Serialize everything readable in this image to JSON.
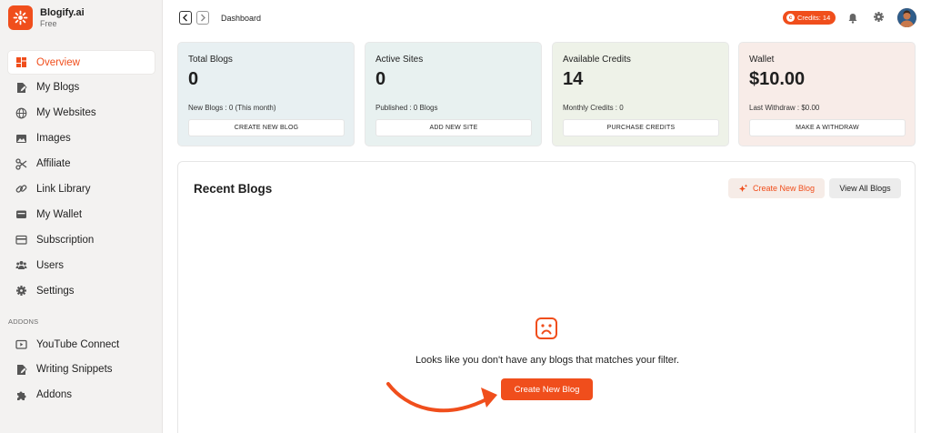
{
  "brand": {
    "name": "Blogify.ai",
    "plan": "Free"
  },
  "sidebar": {
    "items": [
      {
        "label": "Overview",
        "icon": "grid-icon",
        "active": true
      },
      {
        "label": "My Blogs",
        "icon": "edit-doc-icon"
      },
      {
        "label": "My Websites",
        "icon": "globe-icon"
      },
      {
        "label": "Images",
        "icon": "image-icon"
      },
      {
        "label": "Affiliate",
        "icon": "scissors-icon"
      },
      {
        "label": "Link Library",
        "icon": "link-icon"
      },
      {
        "label": "My Wallet",
        "icon": "wallet-icon"
      },
      {
        "label": "Subscription",
        "icon": "card-icon"
      },
      {
        "label": "Users",
        "icon": "users-icon"
      },
      {
        "label": "Settings",
        "icon": "gear-icon"
      }
    ],
    "addons_label": "ADDONS",
    "addons": [
      {
        "label": "YouTube Connect",
        "icon": "youtube-icon"
      },
      {
        "label": "Writing Snippets",
        "icon": "edit-doc-icon"
      },
      {
        "label": "Addons",
        "icon": "puzzle-icon"
      }
    ]
  },
  "topbar": {
    "breadcrumb": "Dashboard",
    "credits_label": "Credits: 14"
  },
  "cards": [
    {
      "title": "Total Blogs",
      "value": "0",
      "sub": "New Blogs : 0 (This month)",
      "button": "CREATE NEW BLOG",
      "bg": "#e8f0f2"
    },
    {
      "title": "Active Sites",
      "value": "0",
      "sub": "Published : 0 Blogs",
      "button": "ADD NEW SITE",
      "bg": "#e8f1f0"
    },
    {
      "title": "Available Credits",
      "value": "14",
      "sub": "Monthly Credits : 0",
      "button": "PURCHASE CREDITS",
      "bg": "#eef2e8"
    },
    {
      "title": "Wallet",
      "value": "$10.00",
      "sub": "Last Withdraw : $0.00",
      "button": "MAKE A WITHDRAW",
      "bg": "#f8ece8"
    }
  ],
  "recent": {
    "title": "Recent Blogs",
    "create_label": "Create New Blog",
    "view_all_label": "View All Blogs",
    "empty_text": "Looks like you don't have any blogs that matches your filter.",
    "empty_button": "Create New Blog"
  },
  "colors": {
    "accent": "#f04e1c",
    "sidebar_bg": "#f3f2f1"
  }
}
